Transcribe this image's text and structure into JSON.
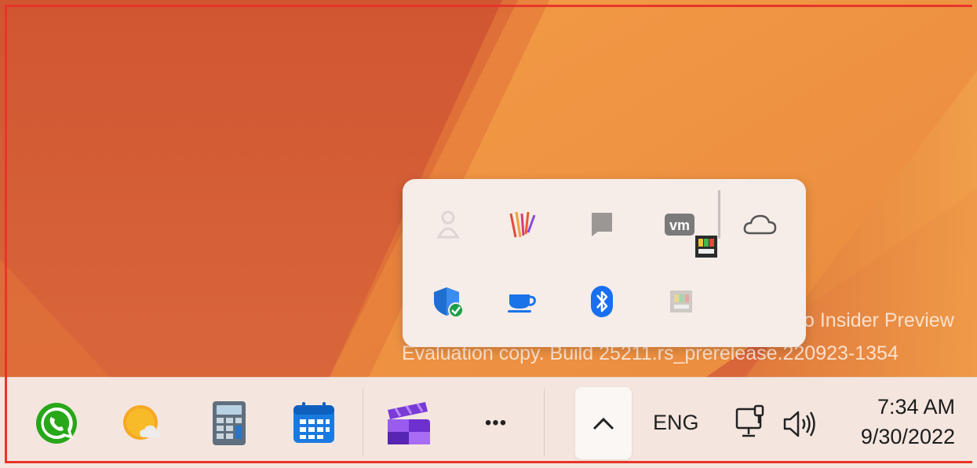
{
  "watermark": {
    "line1": "o Insider Preview",
    "line2": "Evaluation copy. Build 25211.rs_prerelease.220923-1354"
  },
  "tray_flyout": {
    "icons": [
      "person-icon",
      "paint-stripes-icon",
      "gray-flag-icon",
      "vmware-icon",
      "color-meter-icon",
      "onedrive-cloud-icon",
      "windows-security-icon",
      "coffee-cup-icon",
      "bluetooth-icon",
      "faded-app-icon"
    ]
  },
  "taskbar": {
    "apps": [
      "whatsapp-icon",
      "weather-icon",
      "calculator-icon",
      "calendar-icon",
      "clipchamp-icon",
      "more-apps-icon"
    ],
    "more_label": "•••",
    "language": "ENG",
    "time": "7:34 AM",
    "date": "9/30/2022"
  },
  "colors": {
    "frame": "#e8352a",
    "whatsapp": "#29a71a",
    "accent_blue": "#1a73e8",
    "taskbar_bg": "#f4e6df"
  }
}
